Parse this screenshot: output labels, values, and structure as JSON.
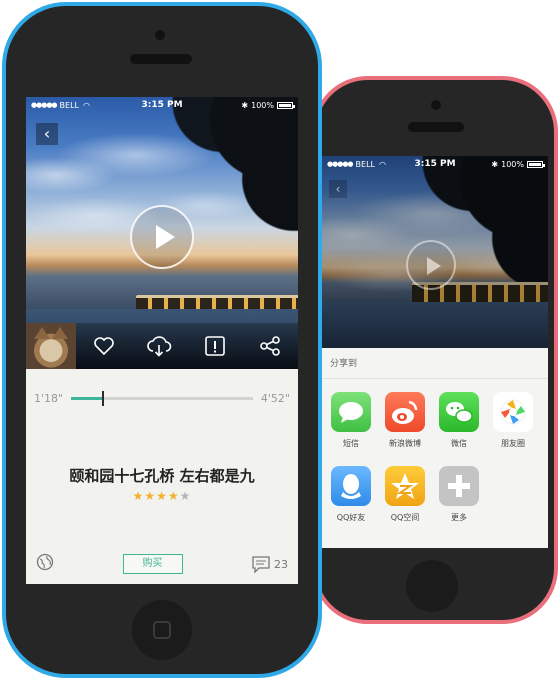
{
  "left_phone": {
    "status": {
      "carrier": "BELL",
      "time": "3:15 PM",
      "battery": "100%"
    },
    "playback": {
      "elapsed": "1'18\"",
      "total": "4'52\"",
      "progress": 0.17
    },
    "title": "颐和园十七孔桥 左右都是九",
    "rating": {
      "value": 4,
      "max": 5
    },
    "buy_label": "购买",
    "comment_count": "23"
  },
  "right_phone": {
    "status": {
      "carrier": "BELL",
      "time": "3:15 PM",
      "battery": "100%"
    },
    "share": {
      "title": "分享到",
      "items": [
        {
          "label": "短信",
          "icon": "sms-icon",
          "color": "#4cd964"
        },
        {
          "label": "新浪微博",
          "icon": "weibo-icon",
          "color": "#f55a3c"
        },
        {
          "label": "微信",
          "icon": "wechat-icon",
          "color": "#3ccb3c"
        },
        {
          "label": "朋友圈",
          "icon": "moments-icon",
          "color": "#ffffff"
        },
        {
          "label": "QQ好友",
          "icon": "qq-icon",
          "color": "#3f9ff2"
        },
        {
          "label": "QQ空间",
          "icon": "qzone-icon",
          "color": "#f5b21a"
        },
        {
          "label": "更多",
          "icon": "plus-icon",
          "color": "#c4c4c4"
        }
      ]
    }
  },
  "colors": {
    "accent": "#3fb59a",
    "left_frame": "#2fa9e8",
    "right_frame": "#e96f7c",
    "star": "#f4b02e"
  }
}
